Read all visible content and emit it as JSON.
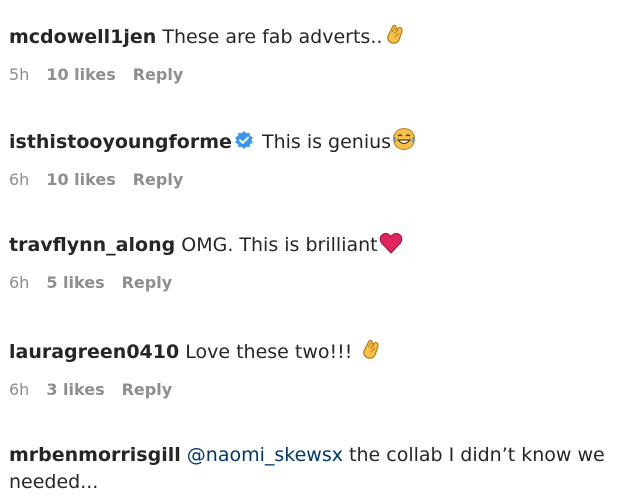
{
  "comments": [
    {
      "username": "mcdowell1jen",
      "text": "These are fab adverts..",
      "emoji": "clapping-hands-icon",
      "time": "5h",
      "likes": "10 likes",
      "reply": "Reply"
    },
    {
      "username": "isthistooyoungforme",
      "verified": true,
      "text": "This is genius",
      "emoji": "laughing-face-icon",
      "time": "6h",
      "likes": "10 likes",
      "reply": "Reply"
    },
    {
      "username": "travflynn_along",
      "text": "OMG. This is brilliant",
      "emoji": "red-heart-icon",
      "time": "6h",
      "likes": "5 likes",
      "reply": "Reply"
    },
    {
      "username": "lauragreen0410",
      "text": "Love these two!!!",
      "emoji": "clapping-hands-icon",
      "time": "6h",
      "likes": "3 likes",
      "reply": "Reply"
    },
    {
      "username": "mrbenmorrisgill",
      "mention": "@naomi_skewsx",
      "text": "the collab I didn’t know we needed..."
    }
  ],
  "colors": {
    "text": "#262626",
    "meta": "#8e8e8e",
    "mention": "#00376b",
    "verified": "#3897f0",
    "heart": "#e0245e"
  }
}
